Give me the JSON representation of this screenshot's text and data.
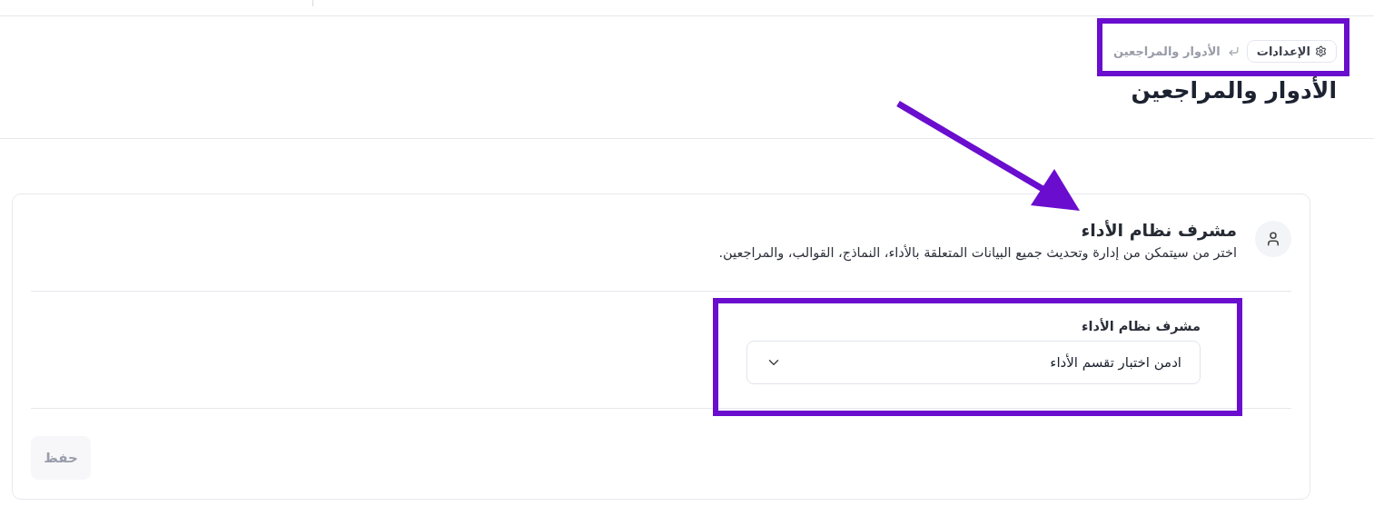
{
  "breadcrumb": [
    {
      "label": "الإعدادات",
      "kind": "root"
    },
    {
      "label": "الأدوار والمراجعين",
      "kind": "current"
    }
  ],
  "page_title": "الأدوار والمراجعين",
  "card": {
    "title": "مشرف نظام الأداء",
    "description": "اختر من سيتمكن من إدارة وتحديث جميع البيانات المتعلقة بالأداء، النماذج، القوالب، والمراجعين.",
    "field": {
      "label": "مشرف نظام الأداء",
      "value": "ادمن اختبار تقسم الأداء"
    },
    "save_button": {
      "label": "حفظ",
      "disabled": true
    }
  }
}
